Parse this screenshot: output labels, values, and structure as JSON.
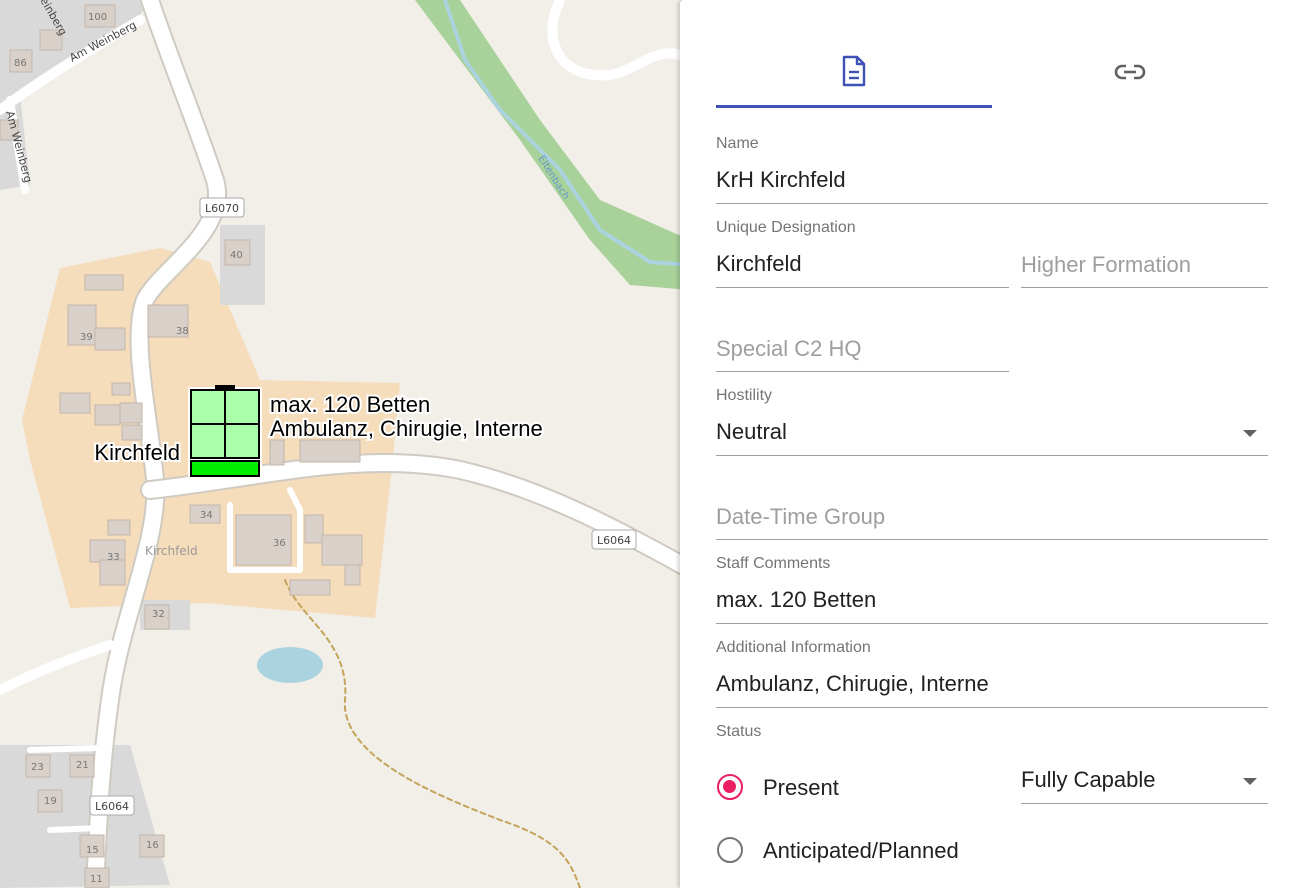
{
  "map": {
    "place_labels": {
      "kirchfeld_village": "Kirchfeld"
    },
    "street_labels": {
      "am_weinberg_top": "Am Weinberg",
      "am_weinberg_side": "Am Weinberg",
      "weinberg_corner": "einberg",
      "stream": "Eltenbach"
    },
    "road_shields": {
      "l6070": "L6070",
      "l6064_east": "L6064",
      "l6064_south": "L6064"
    },
    "house_numbers": {
      "n100": "100",
      "n86": "86",
      "n40": "40",
      "n39": "39",
      "n38": "38",
      "n34": "34",
      "n33": "33",
      "n36": "36",
      "n32": "32",
      "n23": "23",
      "n21": "21",
      "n19": "19",
      "n15": "15",
      "n16": "16",
      "n11": "11"
    },
    "unit_marker": {
      "designation": "Kirchfeld",
      "staff_comments": "max. 120 Betten",
      "additional_information": "Ambulanz, Chirugie, Interne",
      "status_color": "#00ee00",
      "fill_color": "#aaffaa"
    }
  },
  "panel": {
    "tabs": [
      {
        "icon": "document-icon",
        "selected": true
      },
      {
        "icon": "link-icon",
        "selected": false
      }
    ],
    "accent_color": "#3f51b5",
    "radio_color": "#e91e63",
    "fields": {
      "name": {
        "label": "Name",
        "value": "KrH Kirchfeld"
      },
      "unique_designation": {
        "label": "Unique Designation",
        "value": "Kirchfeld"
      },
      "higher_formation": {
        "placeholder": "Higher Formation"
      },
      "special_c2_hq": {
        "placeholder": "Special C2 HQ"
      },
      "hostility": {
        "label": "Hostility",
        "value": "Neutral"
      },
      "date_time_group": {
        "placeholder": "Date-Time Group"
      },
      "staff_comments": {
        "label": "Staff Comments",
        "value": "max. 120 Betten"
      },
      "additional_information": {
        "label": "Additional Information",
        "value": "Ambulanz, Chirugie, Interne"
      },
      "status": {
        "label": "Status"
      },
      "capability": {
        "value": "Fully Capable"
      }
    },
    "status_options": [
      {
        "label": "Present",
        "selected": true
      },
      {
        "label": "Anticipated/Planned",
        "selected": false
      }
    ]
  }
}
